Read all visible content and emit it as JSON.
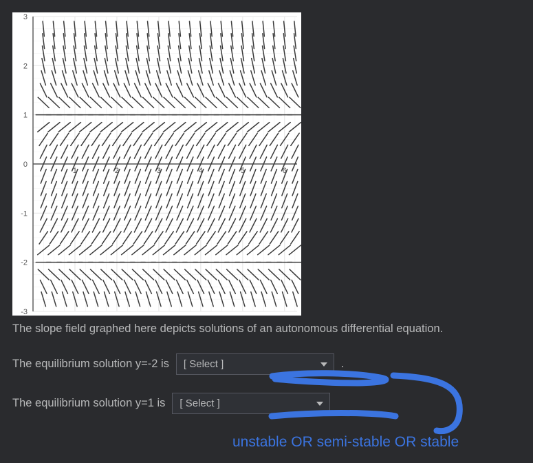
{
  "chart_data": {
    "type": "slope-field",
    "title": "",
    "xlabel": "",
    "ylabel": "",
    "xlim": [
      0,
      6.3
    ],
    "ylim": [
      -3,
      3
    ],
    "xticks": [
      0,
      1,
      2,
      3,
      4,
      5,
      6
    ],
    "yticks": [
      -3,
      -2,
      -1,
      0,
      1,
      2,
      3
    ],
    "segments_x_step": 0.25,
    "segments_y_step": 0.25,
    "segment_length": 0.18,
    "slope_formula": "-(y-1)*(y+2)",
    "equilibria": [
      1,
      -2
    ]
  },
  "caption": "The slope field graphed here depicts solutions of an autonomous differential equation.",
  "questions": [
    {
      "text_prefix": "The equilibrium solution y=-2 is",
      "select_placeholder": "[ Select ]",
      "trailing": "."
    },
    {
      "text_prefix": "The equilibrium solution y=1 is",
      "select_placeholder": "[ Select ]",
      "trailing": ""
    }
  ],
  "select_options": [
    "unstable",
    "semi-stable",
    "stable"
  ],
  "annotation_label": "unstable OR semi-stable OR stable"
}
